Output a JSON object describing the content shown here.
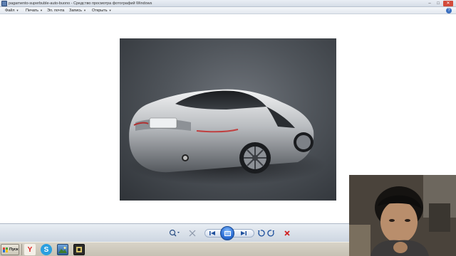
{
  "window": {
    "title": "pagamento-superbuble-auto-buono - Средство просмотра фотографий Windows",
    "minimize_label": "–",
    "maximize_label": "□",
    "close_label": "✕"
  },
  "menu": {
    "items": [
      {
        "label": "Файл"
      },
      {
        "label": "Печать"
      },
      {
        "label": "Эл. почта"
      },
      {
        "label": "Запись"
      },
      {
        "label": "Открыть"
      }
    ],
    "help_label": "?"
  },
  "viewer": {
    "image_icon": "car-photo"
  },
  "toolbar": {
    "buttons": [
      "zoom-icon",
      "actual-size-icon",
      "previous-icon",
      "slideshow-icon",
      "next-icon",
      "rotate-ccw-icon",
      "rotate-cw-icon",
      "delete-icon"
    ]
  },
  "taskbar": {
    "start_label": "Пуск",
    "quick_launch": [
      "yandex-icon",
      "skype-icon",
      "photo-viewer-icon",
      "media-icon"
    ]
  },
  "colors": {
    "accent": "#2c6fd6",
    "delete": "#d02020",
    "toolbar_bg": "#dbe2eb"
  }
}
